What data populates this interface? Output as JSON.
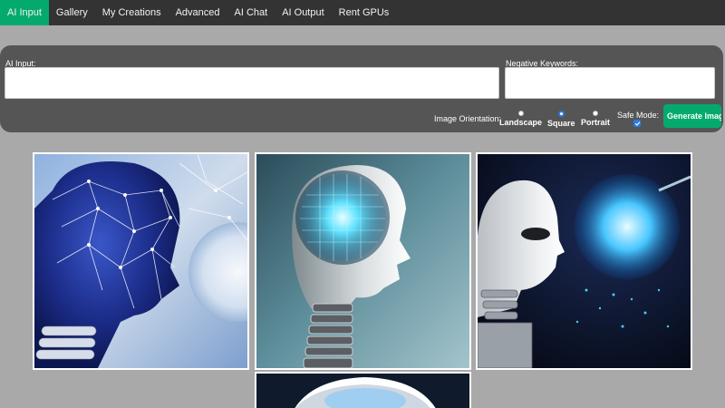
{
  "nav": {
    "tabs": [
      {
        "label": "AI Input",
        "active": true
      },
      {
        "label": "Gallery",
        "active": false
      },
      {
        "label": "My Creations",
        "active": false
      },
      {
        "label": "Advanced",
        "active": false
      },
      {
        "label": "AI Chat",
        "active": false
      },
      {
        "label": "AI Output",
        "active": false
      },
      {
        "label": "Rent GPUs",
        "active": false
      }
    ]
  },
  "form": {
    "ai_input_label": "AI Input:",
    "ai_input_value": "",
    "negative_label": "Negative Keywords:",
    "negative_value": "",
    "orientation_label": "Image Orientation:",
    "orientations": [
      {
        "label": "Landscape",
        "checked": false
      },
      {
        "label": "Square",
        "checked": true
      },
      {
        "label": "Portrait",
        "checked": false
      }
    ],
    "safe_mode_label": "Safe Mode:",
    "safe_mode_checked": true,
    "generate_label": "Generate Image"
  },
  "gallery": {
    "images": [
      {
        "subject": "robot head with glowing network lines"
      },
      {
        "subject": "robot head with glowing circuit brain"
      },
      {
        "subject": "humanoid robot facing glowing sphere"
      },
      {
        "subject": "robot head (partially visible)"
      }
    ]
  },
  "colors": {
    "nav_bg": "#333333",
    "nav_active": "#04aa6d",
    "panel_bg": "#555555",
    "page_bg": "#a9a9a9",
    "accent_blue": "#2a7be4",
    "button_green": "#04aa6d"
  },
  "icons": {
    "checkbox": "check-icon"
  }
}
